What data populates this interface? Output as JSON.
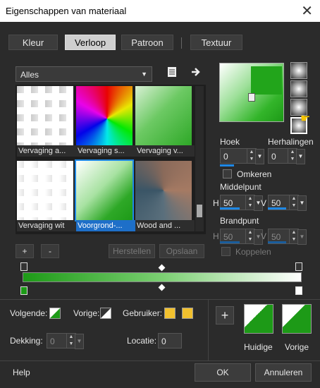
{
  "window": {
    "title": "Eigenschappen van materiaal",
    "close": "✕"
  },
  "tabs": [
    {
      "label": "Kleur",
      "selected": false
    },
    {
      "label": "Verloop",
      "selected": true
    },
    {
      "label": "Patroon",
      "selected": false
    },
    {
      "label": "Textuur",
      "selected": false
    }
  ],
  "category": {
    "selected": "Alles"
  },
  "gallery": {
    "items": [
      {
        "caption": "Vervaging a..."
      },
      {
        "caption": "Vervaging s..."
      },
      {
        "caption": "Vervaging v..."
      },
      {
        "caption": "Vervaging wit"
      },
      {
        "caption": "Voorgrond-..."
      },
      {
        "caption": "Wood and ..."
      }
    ],
    "add": "+",
    "remove": "-",
    "restore": "Herstellen",
    "save": "Opslaan"
  },
  "angle": {
    "label": "Hoek",
    "value": "0"
  },
  "repeats": {
    "label": "Herhalingen",
    "value": "0"
  },
  "invert": {
    "label": "Omkeren"
  },
  "midpoint": {
    "label": "Middelpunt",
    "h_label": "H",
    "h_value": "50",
    "v_label": "V",
    "v_value": "50"
  },
  "focal": {
    "label": "Brandpunt",
    "h_label": "H",
    "h_value": "50",
    "v_label": "V",
    "v_value": "50"
  },
  "link": {
    "label": "Koppelen"
  },
  "bottom": {
    "next_label": "Volgende:",
    "prev_label": "Vorige:",
    "user_label": "Gebruiker:",
    "opacity_label": "Dekking:",
    "opacity_value": "0",
    "location_label": "Locatie:",
    "location_value": "0",
    "add": "+",
    "current_label": "Huidige",
    "previous_label": "Vorige"
  },
  "footer": {
    "help": "Help",
    "ok": "OK",
    "cancel": "Annuleren"
  },
  "colors": {
    "accent": "#1e88e5",
    "green": "#1d9a17",
    "swatch_yellow": "#f2c12e"
  }
}
